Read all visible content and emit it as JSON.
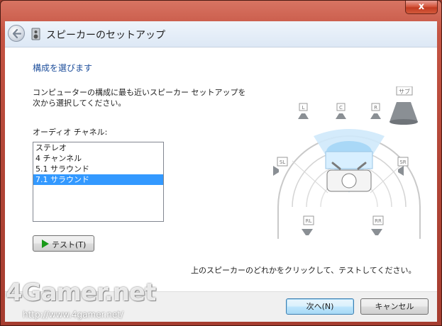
{
  "window": {
    "title": "スピーカーのセットアップ",
    "close_glyph": "x"
  },
  "content": {
    "heading": "構成を選びます",
    "description": "コンピューターの構成に最も近いスピーカー セットアップを次から選択してください。",
    "channels_label": "オーディオ チャネル:",
    "channels": [
      {
        "label": "ステレオ",
        "selected": false
      },
      {
        "label": "4 チャンネル",
        "selected": false
      },
      {
        "label": "5.1 サラウンド",
        "selected": false
      },
      {
        "label": "7.1 サラウンド",
        "selected": true
      }
    ],
    "test_button": "テスト(T)",
    "instruction": "上のスピーカーのどれかをクリックして、テストしてください。"
  },
  "speakers": {
    "sub": "サブ",
    "L": "L",
    "C": "C",
    "R": "R",
    "SL": "SL",
    "SR": "SR",
    "RL": "RL",
    "RR": "RR"
  },
  "footer": {
    "next_button": "次へ(N)",
    "cancel_button": "キャンセル"
  },
  "watermark": {
    "logo": "4Gamer.net",
    "url": "http://www.4gamer.net/"
  },
  "colors": {
    "accent_heading": "#1e4f9c",
    "selection": "#3399ff",
    "frame": "#b24637"
  }
}
